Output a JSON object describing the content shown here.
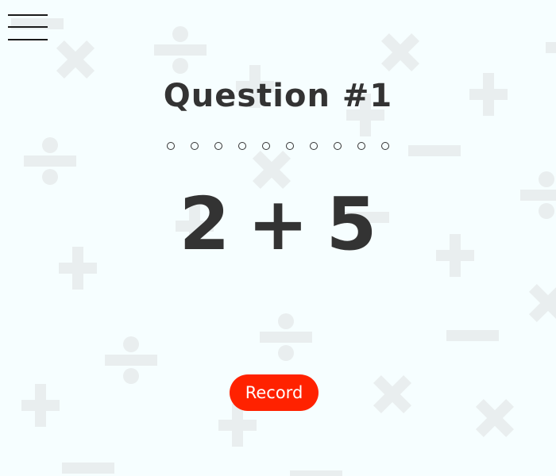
{
  "colors": {
    "background": "#f6feff",
    "symbol": "#e9eeef",
    "text": "#333333",
    "record_button": "#ff2200"
  },
  "menu": {
    "icon": "hamburger-menu-icon"
  },
  "question": {
    "title": "Question #1",
    "progress": {
      "total": 10,
      "completed": 0
    }
  },
  "problem": {
    "left": "2",
    "operator": "+",
    "right": "5"
  },
  "record_button": {
    "label": "Record"
  }
}
